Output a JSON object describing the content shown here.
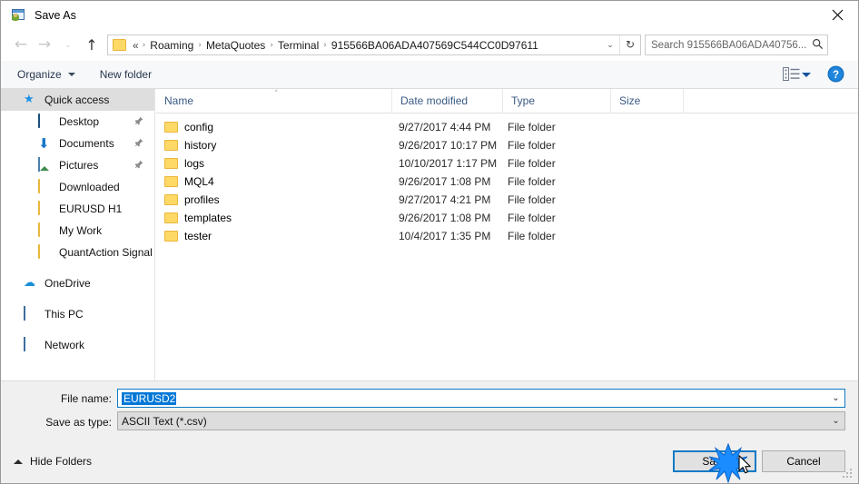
{
  "window": {
    "title": "Save As",
    "app_icon": "save-as-app-icon",
    "close_label": "×"
  },
  "nav": {
    "back": "←",
    "forward": "→",
    "recent": "⌄",
    "up": "↑"
  },
  "address": {
    "folder_icon": "folder-icon",
    "prefix": "«",
    "crumbs": [
      "Roaming",
      "MetaQuotes",
      "Terminal",
      "915566BA06ADA407569C544CC0D97611"
    ],
    "separator": "›",
    "dropdown": "⌄",
    "refresh": "↻"
  },
  "search": {
    "placeholder": "Search 915566BA06ADA40756...",
    "value": "",
    "icon": "search-icon"
  },
  "toolbar": {
    "organize": "Organize",
    "new_folder": "New folder",
    "view_icon": "view-layout-icon",
    "help_icon": "help-icon"
  },
  "sidebar": {
    "items": [
      {
        "label": "Quick access",
        "icon": "star-icon",
        "level": 0,
        "selected": true,
        "pinned": false
      },
      {
        "label": "Desktop",
        "icon": "desktop-icon",
        "level": 1,
        "selected": false,
        "pinned": true
      },
      {
        "label": "Documents",
        "icon": "documents-icon",
        "level": 1,
        "selected": false,
        "pinned": true
      },
      {
        "label": "Pictures",
        "icon": "pictures-icon",
        "level": 1,
        "selected": false,
        "pinned": true
      },
      {
        "label": "Downloaded",
        "icon": "folder-icon",
        "level": 1,
        "selected": false,
        "pinned": false
      },
      {
        "label": "EURUSD H1",
        "icon": "folder-icon",
        "level": 1,
        "selected": false,
        "pinned": false
      },
      {
        "label": "My Work",
        "icon": "folder-icon",
        "level": 1,
        "selected": false,
        "pinned": false
      },
      {
        "label": "QuantAction Signal",
        "icon": "folder-icon",
        "level": 1,
        "selected": false,
        "pinned": false
      },
      {
        "label": "OneDrive",
        "icon": "onedrive-icon",
        "level": 0,
        "selected": false,
        "pinned": false
      },
      {
        "label": "This PC",
        "icon": "this-pc-icon",
        "level": 0,
        "selected": false,
        "pinned": false
      },
      {
        "label": "Network",
        "icon": "network-icon",
        "level": 0,
        "selected": false,
        "pinned": false
      }
    ]
  },
  "filelist": {
    "columns": [
      "Name",
      "Date modified",
      "Type",
      "Size"
    ],
    "sort_indicator": "˄",
    "rows": [
      {
        "name": "config",
        "date": "9/27/2017 4:44 PM",
        "type": "File folder",
        "size": ""
      },
      {
        "name": "history",
        "date": "9/26/2017 10:17 PM",
        "type": "File folder",
        "size": ""
      },
      {
        "name": "logs",
        "date": "10/10/2017 1:17 PM",
        "type": "File folder",
        "size": ""
      },
      {
        "name": "MQL4",
        "date": "9/26/2017 1:08 PM",
        "type": "File folder",
        "size": ""
      },
      {
        "name": "profiles",
        "date": "9/27/2017 4:21 PM",
        "type": "File folder",
        "size": ""
      },
      {
        "name": "templates",
        "date": "9/26/2017 1:08 PM",
        "type": "File folder",
        "size": ""
      },
      {
        "name": "tester",
        "date": "10/4/2017 1:35 PM",
        "type": "File folder",
        "size": ""
      }
    ]
  },
  "form": {
    "filename_label": "File name:",
    "filename_value": "EURUSD2",
    "filetype_label": "Save as type:",
    "filetype_value": "ASCII Text (*.csv)",
    "dropdown_arrow": "⌄"
  },
  "footer": {
    "hide_folders": "Hide Folders",
    "save": "Save",
    "cancel": "Cancel"
  },
  "colors": {
    "accent": "#0d7ac4",
    "selection": "#0078d7",
    "folder": "#ffd966",
    "header_text": "#3a5a84",
    "panel": "#f0f0f0"
  }
}
